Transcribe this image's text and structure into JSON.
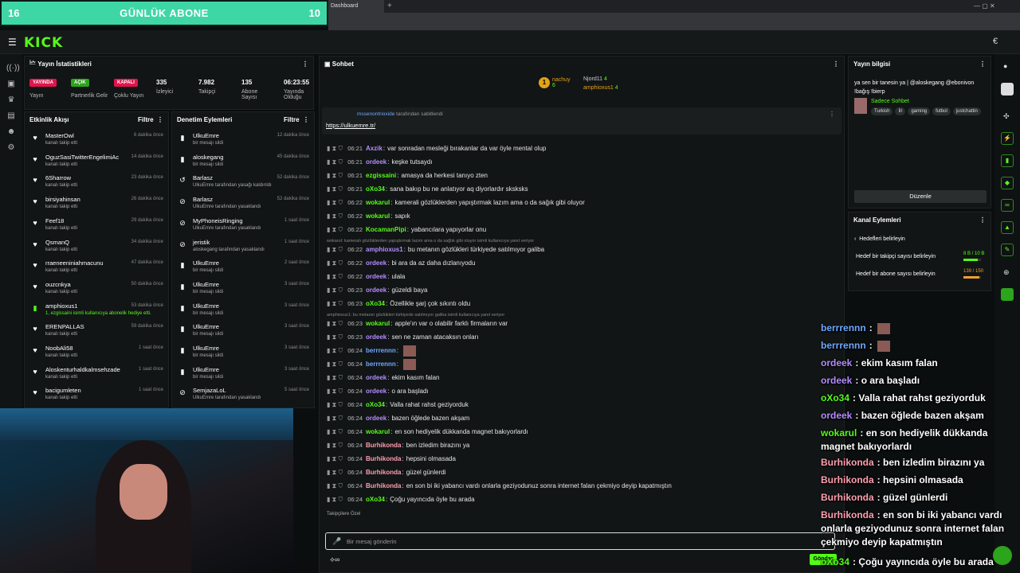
{
  "goal": {
    "left": "16",
    "title": "GÜNLÜK ABONE",
    "right": "10"
  },
  "browser": {
    "tab": "Dashboard"
  },
  "brand": "KICK",
  "stats": {
    "title": "Yayın İstatistikleri",
    "badges": [
      "YAYINDA",
      "AÇIK",
      "KAPALI"
    ],
    "labels": [
      "Yayın",
      "Partnerlik Gelir",
      "Çoklu Yayın",
      "İzleyici",
      "Takipçi",
      "Abone Sayısı",
      "Yayında Olduğu"
    ],
    "values": [
      "335",
      "7.982",
      "135",
      "06:23:55"
    ]
  },
  "activity": {
    "title": "Etkinlik Akışı",
    "filter": "Filtre",
    "items": [
      {
        "name": "MasterOwl",
        "sub": "kanalı takip etti",
        "time": "6 dakika önce"
      },
      {
        "name": "OguzSasiTwitterEngelimiAc",
        "sub": "kanalı takip etti",
        "time": "14 dakika önce"
      },
      {
        "name": "6Sharrow",
        "sub": "kanalı takip etti",
        "time": "23 dakika önce"
      },
      {
        "name": "birsiyahinsan",
        "sub": "kanalı takip etti",
        "time": "26 dakika önce"
      },
      {
        "name": "Feef18",
        "sub": "kanalı takip etti",
        "time": "29 dakika önce"
      },
      {
        "name": "QsmanQ",
        "sub": "kanalı takip etti",
        "time": "34 dakika önce"
      },
      {
        "name": "rraeneeniniahmacunu",
        "sub": "kanalı takip etti",
        "time": "47 dakika önce"
      },
      {
        "name": "ouzcnkya",
        "sub": "kanalı takip etti",
        "time": "50 dakika önce"
      },
      {
        "name": "amphioxus1",
        "sub": "1, ezgissaini isimli kullanıcıya abonelik hediye etti.",
        "time": "53 dakika önce"
      },
      {
        "name": "ERENPALLAS",
        "sub": "kanalı takip etti",
        "time": "59 dakika önce"
      },
      {
        "name": "NoobAli58",
        "sub": "kanalı takip etti",
        "time": "1 saat önce"
      },
      {
        "name": "Aloskenturhaldkalmsehzade",
        "sub": "kanalı takip etti",
        "time": "1 saat önce"
      },
      {
        "name": "bacigumleten",
        "sub": "kanalı takip etti",
        "time": "1 saat önce"
      }
    ]
  },
  "moderation": {
    "title": "Denetim Eylemleri",
    "filter": "Filtre",
    "items": [
      {
        "name": "UlkuEmre",
        "sub": "bir mesajı sildi",
        "time": "12 dakika önce"
      },
      {
        "name": "aloskegang",
        "sub": "bir mesajı sildi",
        "time": "45 dakika önce"
      },
      {
        "name": "Barlasz",
        "sub": "UlkuEmre tarafından yasağı kaldırıldı",
        "time": "52 dakika önce"
      },
      {
        "name": "Barlasz",
        "sub": "UlkuEmre tarafından yasaklandı",
        "time": "52 dakika önce"
      },
      {
        "name": "MyPhoneisRinging",
        "sub": "UlkuEmre tarafından yasaklandı",
        "time": "1 saat önce"
      },
      {
        "name": "jeristik",
        "sub": "aloskegang tarafından yasaklandı",
        "time": "1 saat önce"
      },
      {
        "name": "UlkuEmre",
        "sub": "bir mesajı sildi",
        "time": "2 saat önce"
      },
      {
        "name": "UlkuEmre",
        "sub": "bir mesajı sildi",
        "time": "3 saat önce"
      },
      {
        "name": "UlkuEmre",
        "sub": "bir mesajı sildi",
        "time": "3 saat önce"
      },
      {
        "name": "UlkuEmre",
        "sub": "bir mesajı sildi",
        "time": "3 saat önce"
      },
      {
        "name": "UlkuEmre",
        "sub": "bir mesajı sildi",
        "time": "3 saat önce"
      },
      {
        "name": "UlkuEmre",
        "sub": "bir mesajı sildi",
        "time": "3 saat önce"
      },
      {
        "name": "SemjazaLoL",
        "sub": "UlkuEmre tarafından yasaklandı",
        "time": "5 saat önce"
      }
    ]
  },
  "chat": {
    "title": "Sohbet",
    "top": [
      {
        "name": "nachuy",
        "n": "6"
      },
      {
        "name": "Njord11",
        "n": "4"
      },
      {
        "name": "amphioxus1",
        "n": "4"
      }
    ],
    "pinned": {
      "by": "mssenontrioxide",
      "suffix": "tarafından sabitlendi",
      "link": "https://ulkuemre.tr/"
    },
    "messages": [
      {
        "t": "06:21",
        "u": "Axzik",
        "c": "#b48cff",
        "m": "var sonradan mesleği bırakanlar da var öyle mental olup"
      },
      {
        "t": "06:21",
        "u": "ordeek",
        "c": "#b48cff",
        "m": "keşke tutsaydı"
      },
      {
        "t": "06:21",
        "u": "ezgissaini",
        "c": "#53fc18",
        "m": "amasya da herkesi tanıyo zten"
      },
      {
        "t": "06:21",
        "u": "oXo34",
        "c": "#53fc18",
        "m": "sana bakıp bu ne anlatıyor aq diyorlardır sksksks"
      },
      {
        "t": "06:22",
        "u": "wokarul",
        "c": "#53fc18",
        "m": "kamerali gözlüklerden yapıştırmak lazım ama o da sağık gibi oluyor"
      },
      {
        "t": "06:22",
        "u": "wokarul",
        "c": "#53fc18",
        "m": "sapık"
      },
      {
        "t": "06:22",
        "u": "KocamanPipi",
        "c": "#53fc18",
        "m": "yabancılara yapıyorlar onu"
      },
      {
        "t": "06:22",
        "u": "amphioxus1",
        "c": "#b48cff",
        "m": "bu metanın gözlükleri türkiyede satılmıyor galiba"
      },
      {
        "t": "06:22",
        "u": "ordeek",
        "c": "#b48cff",
        "m": "bi ara da az daha dızlanıyodu"
      },
      {
        "t": "06:22",
        "u": "ordeek",
        "c": "#b48cff",
        "m": "ulala"
      },
      {
        "t": "06:23",
        "u": "ordeek",
        "c": "#b48cff",
        "m": "güzeldi baya"
      },
      {
        "t": "06:23",
        "u": "oXo34",
        "c": "#53fc18",
        "m": "Özellikle şarj çok sıkıntı oldu"
      },
      {
        "t": "06:23",
        "u": "wokarul",
        "c": "#53fc18",
        "m": "apple'ın var o olabilir farklı firmaların var"
      },
      {
        "t": "06:23",
        "u": "ordeek",
        "c": "#b48cff",
        "m": "sen ne zaman atacaksın onları"
      },
      {
        "t": "06:24",
        "u": "berrrennn",
        "c": "#6fa8ff",
        "m": ""
      },
      {
        "t": "06:24",
        "u": "berrrennn",
        "c": "#6fa8ff",
        "m": ""
      },
      {
        "t": "06:24",
        "u": "ordeek",
        "c": "#b48cff",
        "m": "ekim kasım falan"
      },
      {
        "t": "06:24",
        "u": "ordeek",
        "c": "#b48cff",
        "m": "o ara başladı"
      },
      {
        "t": "06:24",
        "u": "oXo34",
        "c": "#53fc18",
        "m": "Valla rahat rahst geziyorduk"
      },
      {
        "t": "06:24",
        "u": "ordeek",
        "c": "#b48cff",
        "m": "bazen öğlede bazen akşam"
      },
      {
        "t": "06:24",
        "u": "wokarul",
        "c": "#53fc18",
        "m": "en son hediyelik dükkanda magnet bakıyorlardı"
      },
      {
        "t": "06:24",
        "u": "Burhikonda",
        "c": "#ff9fb0",
        "m": "ben izledim birazını ya"
      },
      {
        "t": "06:24",
        "u": "Burhikonda",
        "c": "#ff9fb0",
        "m": "hepsini olmasada"
      },
      {
        "t": "06:24",
        "u": "Burhikonda",
        "c": "#ff9fb0",
        "m": "güzel günlerdi"
      },
      {
        "t": "06:24",
        "u": "Burhikonda",
        "c": "#ff9fb0",
        "m": "en son bi iki yabancı vardı onlarla geziyodunuz sonra internet falan çekmiyo deyip kapatmıştın"
      },
      {
        "t": "06:24",
        "u": "oXo34",
        "c": "#53fc18",
        "m": "Çoğu yayıncıda öyle bu arada"
      }
    ],
    "reply1": "wokarul: kameralı gözlüklerden yapıştırmak lazım ama o da sağlık gibi oluyor isimli kullanıcıya yanıt veriyor",
    "reply2": "amphioxus1: bu metanın gözlükleri türkiyede satılmıyor galiba isimli kullanıcıya yanıt veriyor",
    "followers": "Takipçilere Özel",
    "input_placeholder": "Bir mesaj gönderin",
    "send": "Gönder"
  },
  "streaminfo": {
    "title": "Yayın bilgisi",
    "text": "ya sen bir tanesin ya | @aloskegang @ebonivon !bağış !bierp",
    "category": "Sadece Sohbet",
    "tags": [
      "Turkish",
      "İri",
      "gaming",
      "futbol",
      "justchattin"
    ],
    "edit": "Düzenle"
  },
  "channel": {
    "title": "Kanal Eylemleri",
    "goals_title": "Hedefleri belirleyin",
    "goals": [
      {
        "label": "Hedef bir takipçi sayısı belirleyin",
        "value": "8 B / 10 B",
        "fill": 0.8
      },
      {
        "label": "Hedef bir abone sayısı belirleyin",
        "value": "139 / 150",
        "fill": 0.93
      }
    ]
  },
  "overlay": [
    {
      "u": "berrrennn",
      "c": "#6fa8ff",
      "m": ""
    },
    {
      "u": "berrrennn",
      "c": "#6fa8ff",
      "m": ""
    },
    {
      "u": "ordeek",
      "c": "#b48cff",
      "m": "ekim kasım falan"
    },
    {
      "u": "ordeek",
      "c": "#b48cff",
      "m": "o ara başladı"
    },
    {
      "u": "oXo34",
      "c": "#53fc18",
      "m": "Valla rahat rahst geziyorduk"
    },
    {
      "u": "ordeek",
      "c": "#b48cff",
      "m": "bazen öğlede bazen akşam"
    },
    {
      "u": "wokarul",
      "c": "#53fc18",
      "m": "en son hediyelik dükkanda magnet bakıyorlardı"
    },
    {
      "u": "Burhikonda",
      "c": "#ff9fb0",
      "m": "ben izledim birazını ya"
    },
    {
      "u": "Burhikonda",
      "c": "#ff9fb0",
      "m": "hepsini olmasada"
    },
    {
      "u": "Burhikonda",
      "c": "#ff9fb0",
      "m": "güzel günlerdi"
    },
    {
      "u": "Burhikonda",
      "c": "#ff9fb0",
      "m": "en son bi iki yabancı vardı onlarla geziyodunuz sonra internet falan çekmiyo deyip kapatmıştın"
    },
    {
      "u": "oXo34",
      "c": "#53fc18",
      "m": "Çoğu yayıncıda öyle bu arada"
    }
  ]
}
